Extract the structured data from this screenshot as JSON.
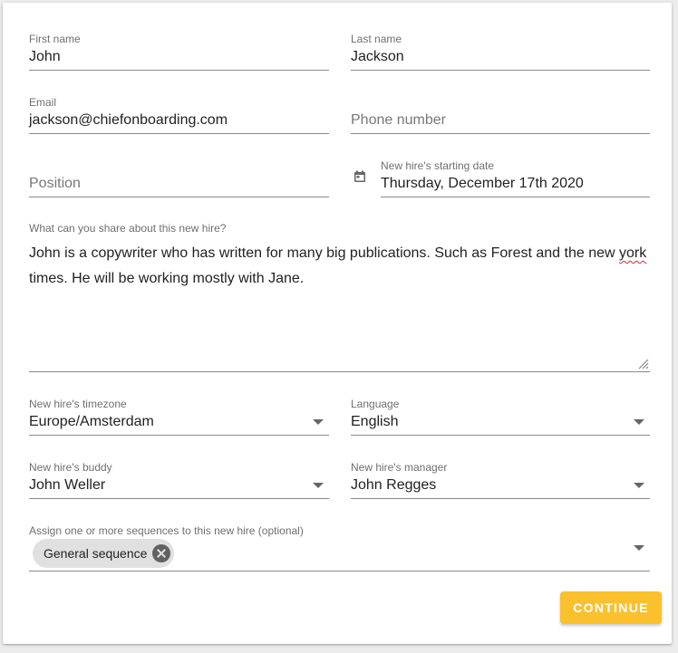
{
  "form": {
    "first_name": {
      "label": "First name",
      "value": "John"
    },
    "last_name": {
      "label": "Last name",
      "value": "Jackson"
    },
    "email": {
      "label": "Email",
      "value": "jackson@chiefonboarding.com"
    },
    "phone": {
      "placeholder": "Phone number"
    },
    "position": {
      "placeholder": "Position"
    },
    "start_date": {
      "label": "New hire's starting date",
      "value": "Thursday, December 17th 2020"
    },
    "about": {
      "label": "What can you share about this new hire?",
      "text_before": "John is a copywriter who has written for many big publications. Such as Forest and the new ",
      "misspelled": "york",
      "text_after": " times. He will be working mostly with Jane."
    },
    "timezone": {
      "label": "New hire's timezone",
      "value": "Europe/Amsterdam"
    },
    "language": {
      "label": "Language",
      "value": "English"
    },
    "buddy": {
      "label": "New hire's buddy",
      "value": "John Weller"
    },
    "manager": {
      "label": "New hire's manager",
      "value": "John Regges"
    },
    "sequences": {
      "label": "Assign one or more sequences to this new hire (optional)",
      "chips": [
        "General sequence"
      ]
    }
  },
  "actions": {
    "continue_label": "CONTINUE"
  },
  "colors": {
    "accent": "#fbc12d",
    "underline": "#8a8a8a",
    "label": "#6f6f6f"
  },
  "icons": {
    "date": "calendar-icon",
    "select": "caret-down-icon",
    "chip_remove": "close-circle-icon"
  }
}
